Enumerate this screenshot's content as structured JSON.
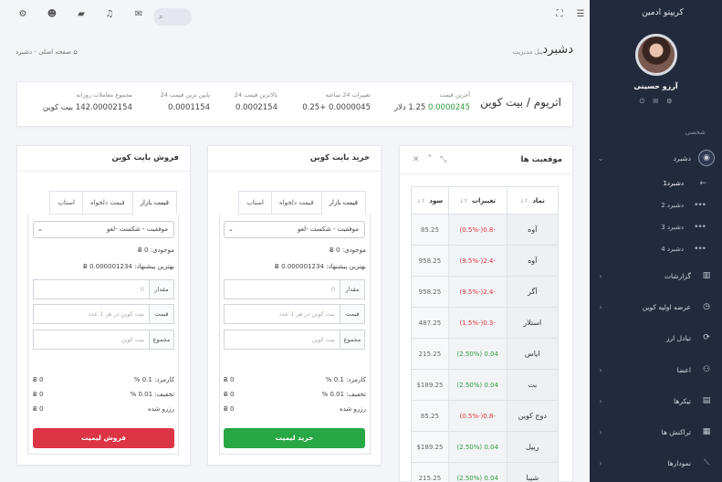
{
  "sidebar": {
    "brand": "کریپتو ادمین",
    "user_name": "آرزو حسینی",
    "section": "شخصی",
    "items": [
      {
        "label": "دشبرد",
        "icon": "eye-icon"
      },
      {
        "label": "گزارشات",
        "icon": "bar-chart-icon"
      },
      {
        "label": "عرضه اولیه کوین",
        "icon": "clock-icon"
      },
      {
        "label": "تبادل ارز",
        "icon": "refresh-icon"
      },
      {
        "label": "اعضا",
        "icon": "user-icon"
      },
      {
        "label": "تیکرها",
        "icon": "ticker-icon"
      },
      {
        "label": "تراکنش ها",
        "icon": "receipt-icon"
      },
      {
        "label": "نمودارها",
        "icon": "line-chart-icon"
      }
    ],
    "sub_items": [
      "دشبرد1",
      "دشبرد 2",
      "دشبرد 3",
      "دشبرد 4"
    ]
  },
  "header": {
    "page_title": "دشبرد",
    "page_subtitle": "پنل مدیریت",
    "breadcrumb_home": "صفحه اصلی",
    "breadcrumb_sep": "-",
    "breadcrumb_current": "دشبرد"
  },
  "stats": {
    "pair": "اتریوم / بیت کوین",
    "last_price_label": "آخرین قیمت",
    "last_price": "0.0000245",
    "last_price_usd": "1.25 دلار",
    "change_label": "تغییرات 24 ساعته",
    "change_value": "0.0000045",
    "change_pct": "+0.25",
    "high_label": "بالاترین قیمت 24",
    "high_value": "0.0002154",
    "low_label": "پایین ترین قیمت 24",
    "low_value": "0.0001154",
    "volume_label": "مجموع معاملات روزانه",
    "volume_value": "142.00002154 بیت کوین"
  },
  "positions": {
    "title": "موقعیت ها",
    "headers": [
      "نماد",
      "تغییرات",
      "سود"
    ],
    "rows": [
      {
        "name": "آوه",
        "change": "-0.8(-0.5%)",
        "profit": "85.25",
        "up": false
      },
      {
        "name": "آوه",
        "change": "-2.4(-9.5%)",
        "profit": "958.25",
        "up": false
      },
      {
        "name": "آگر",
        "change": "-2.4(-9.5%)",
        "profit": "958.25",
        "up": false
      },
      {
        "name": "استلار",
        "change": "-0.3(-1.5%)",
        "profit": "487.25",
        "up": false
      },
      {
        "name": "ایاس",
        "change": "0.04 (2.50%)",
        "profit": "215.25",
        "up": true
      },
      {
        "name": "بت",
        "change": "0.04 (2.50%)",
        "profit": "$189.25",
        "up": true
      },
      {
        "name": "دوج کوین",
        "change": "-0.8(-0.5%)",
        "profit": "85.25",
        "up": false
      },
      {
        "name": "ریپل",
        "change": "0.04 (2.50%)",
        "profit": "$189.25",
        "up": true
      },
      {
        "name": "شیبا",
        "change": "0.04 (2.50%)",
        "profit": "215.25",
        "up": true
      }
    ]
  },
  "buy": {
    "title": "خرید بایت کوین",
    "tabs": [
      "قیمت بازار",
      "قیمت دلخواه",
      "استاپ"
    ],
    "select": "موفقیت - شکست -لغو",
    "balance": "موجودی: 0 Ƀ",
    "best_offer": "بهترین پیشنهاد: 0.000001234 Ƀ",
    "amount_label": "مقدار",
    "amount_placeholder": "0",
    "price_label": "قیمت",
    "price_placeholder": "بیت کوین در هر 1 عدد",
    "total_label": "مجموع",
    "total_placeholder": "بیت کوین",
    "fee": "کارمزد: 0.1 %",
    "discount": "تخفیف: 0.01 %",
    "reserve": "رزرو شده",
    "fee_value": "0 Ƀ",
    "discount_value": "0 Ƀ",
    "reserve_value": "0 Ƀ",
    "button": "خرید لیمیت"
  },
  "sell": {
    "title": "فروش بایت کوین",
    "tabs": [
      "قیمت بازار",
      "قیمت دلخواه",
      "استاپ"
    ],
    "select": "موفقیت - شکست -لغو",
    "balance": "موجودی: 0 Ƀ",
    "best_offer": "بهترین پیشنهاد: 0.000001234 Ƀ",
    "amount_label": "مقدار",
    "amount_placeholder": "0",
    "price_label": "قیمت",
    "price_placeholder": "بیت کوین در هر 1 عدد",
    "total_label": "مجموع",
    "total_placeholder": "بیت کوین",
    "fee": "کارمزد: 0.1 %",
    "discount": "تخفیف: 0.01 %",
    "reserve": "رزرو شده",
    "fee_value": "0 Ƀ",
    "discount_value": "0 Ƀ",
    "reserve_value": "0 Ƀ",
    "button": "فروش لیمیت"
  },
  "colors": {
    "sidebar_bg": "#222b3e",
    "buy": "#28a745",
    "sell": "#dc3545",
    "up": "#2d9a3e",
    "down": "#d9363e"
  }
}
